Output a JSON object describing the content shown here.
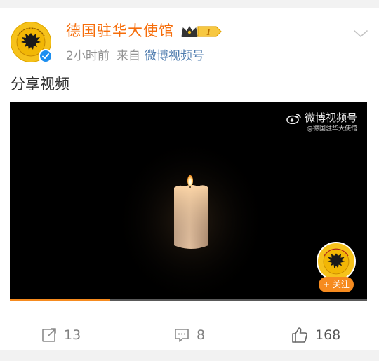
{
  "post": {
    "author": "德国驻华大使馆",
    "time": "2小时前",
    "from_label": "来自",
    "source": "微博视频号",
    "text": "分享视频"
  },
  "badge": {
    "level": "I"
  },
  "video": {
    "watermark_title": "微博视频号",
    "watermark_sub": "@德国驻华大使馆",
    "follow_label": "+ 关注",
    "progress": 0.28
  },
  "actions": {
    "repost_count": "13",
    "comment_count": "8",
    "like_count": "168"
  },
  "colors": {
    "author": "#f66d0a",
    "source_link": "#507daf",
    "accent": "#f68b1f",
    "verified": "#1d8ff0"
  },
  "icons": [
    "avatar-eagle-emblem",
    "verified-check-icon",
    "vip-crown-badge",
    "chevron-down-icon",
    "weibo-logo-icon",
    "repost-icon",
    "comment-icon",
    "like-icon"
  ]
}
